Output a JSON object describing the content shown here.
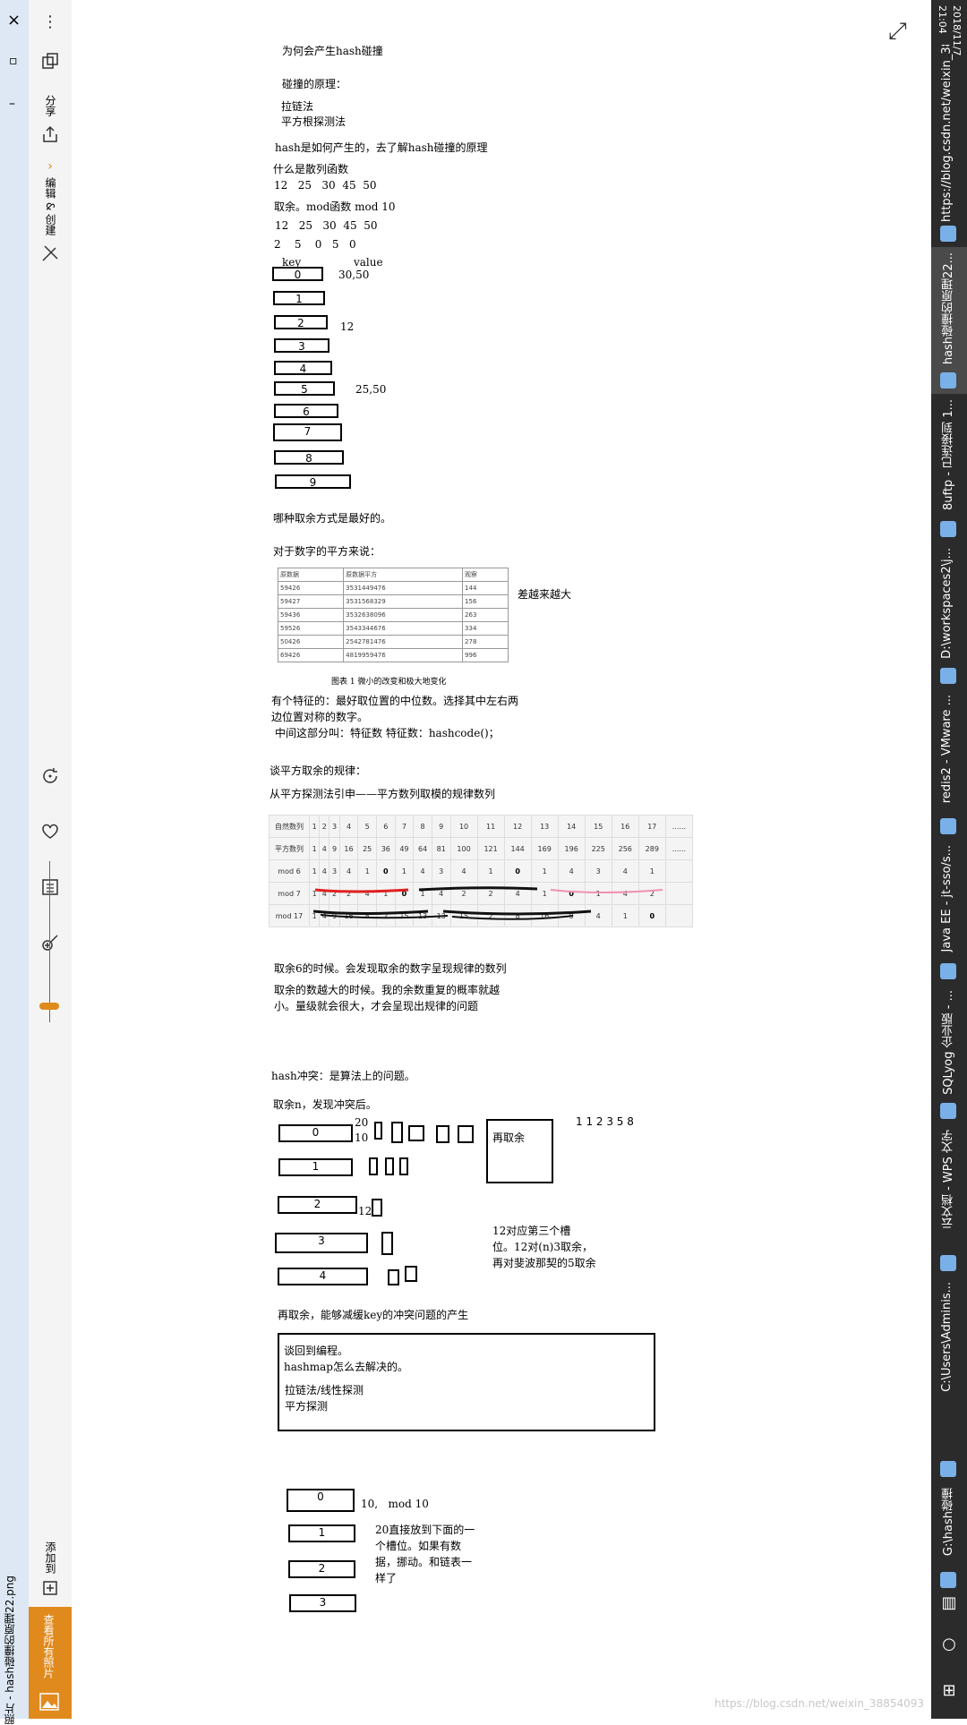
{
  "left_strip": {
    "label": "照片 - hash碰撞的原理22.png",
    "close": "×",
    "minimize": "–",
    "restore": "▫"
  },
  "toolbar": {
    "more": "⋮",
    "share_label": "分享",
    "edit_label": "编辑 & 创建",
    "chevron": "›",
    "add_to_label": "添加到",
    "view_all_label": "查看所有照片",
    "zoom_level": 0.1
  },
  "expand_icon": "⤢",
  "taskbar": {
    "time": "21:04",
    "date": "2018/11/7",
    "items": [
      {
        "label": "https://blog.csdn.net/weixin_38854093"
      },
      {
        "label": "hash碰撞的原理22..."
      },
      {
        "label": "8uftp - 已连接到 1..."
      },
      {
        "label": "D:\\workspaces2\\j..."
      },
      {
        "label": "redis2 - VMware ..."
      },
      {
        "label": "Java EE - jt-sso/s..."
      },
      {
        "label": "SQLyog 企业版 - ..."
      },
      {
        "label": "云文档 - WPS 文字"
      },
      {
        "label": "C:\\Users\\Adminis..."
      },
      {
        "label": "G:\\hash碰撞"
      }
    ]
  },
  "watermark": "https://blog.csdn.net/weixin_38854093",
  "notes": {
    "title": "为何会产生hash碰撞",
    "principle": "碰撞的原理：",
    "method1": "拉链法",
    "method2": "平方根探测法",
    "how": "hash是如何产生的，去了解hash碰撞的原理",
    "what_hash": "什么是散列函数",
    "nums1": "12   25   30  45  50",
    "mod_title": "取余。mod函数 mod 10",
    "nums2": "12   25   30  45  50",
    "nums3": "2    5    0   5   0",
    "key": "key",
    "value": "value",
    "slots": [
      "0",
      "1",
      "2",
      "3",
      "4",
      "5",
      "6",
      "7",
      "8",
      "9"
    ],
    "slot_values": {
      "s0": "30,50",
      "s2": "12",
      "s5": "25,50"
    },
    "best": "哪种取余方式是最好的。",
    "square_intro": "对于数字的平方来说：",
    "diff_note": "差越来越大",
    "caption": "图表 1 微小的改变和极大地变化",
    "feature1": "有个特征的：最好取位置的中位数。选择其中左右两",
    "feature2": "边位置对称的数字。",
    "feature3": "中间这部分叫：特征数    特征数：hashcode()；",
    "rule_title": "谈平方取余的规律：",
    "rule_sub": "从平方探测法引申——平方数列取模的规律数列",
    "obs1": "取余6的时候。会发现取余的数字呈现规律的数列",
    "obs2": "取余的数越大的时候。我的余数重复的概率就越",
    "obs3": "小。量级就会很大，才会呈现出规律的问题",
    "conflict": "hash冲突：是算法上的问题。",
    "after": "取余n，发现冲突后。",
    "v20": "20",
    "v10": "10",
    "v12": "12",
    "reremain": "再取余",
    "fib": "1 1 2 3 5 8",
    "slot12_1": "12对应第三个槽",
    "slot12_2": "位。12对(n)3取余，",
    "slot12_3": "再对斐波那契的5取余",
    "reduce": "再取余，能够减缓key的冲突问题的产生",
    "box1": "谈回到编程。",
    "box2": "hashmap怎么去解决的。",
    "box3": "拉链法/线性探测",
    "box4": "平方探测",
    "bottom_mod": "10,   mod 10",
    "b1": "20直接放到下面的一",
    "b2": "个槽位。如果有数",
    "b3": "据，挪动。和链表一",
    "b4": "样了",
    "slots2": [
      "0",
      "1",
      "2",
      "3",
      "4"
    ],
    "slots3": [
      "0",
      "1",
      "2",
      "3"
    ]
  },
  "small_table": {
    "header": [
      "原数据",
      "原数据平方",
      "观察"
    ],
    "rows": [
      [
        "59426",
        "3531449476",
        "144"
      ],
      [
        "59427",
        "3531568329",
        "156"
      ],
      [
        "59436",
        "3532638096",
        "263"
      ],
      [
        "59526",
        "3543344676",
        "334"
      ],
      [
        "50426",
        "2542781476",
        "278"
      ],
      [
        "69426",
        "4819959476",
        "996"
      ]
    ]
  },
  "seq_table": {
    "rows": [
      {
        "label": "自然数列",
        "cells": [
          "1",
          "2",
          "3",
          "4",
          "5",
          "6",
          "7",
          "8",
          "9",
          "10",
          "11",
          "12",
          "13",
          "14",
          "15",
          "16",
          "17",
          "......"
        ]
      },
      {
        "label": "平方数列",
        "cells": [
          "1",
          "4",
          "9",
          "16",
          "25",
          "36",
          "49",
          "64",
          "81",
          "100",
          "121",
          "144",
          "169",
          "196",
          "225",
          "256",
          "289",
          "......"
        ]
      },
      {
        "label": "mod 6",
        "cells": [
          "1",
          "4",
          "3",
          "4",
          "1",
          "0",
          "1",
          "4",
          "3",
          "4",
          "1",
          "0",
          "1",
          "4",
          "3",
          "4",
          "1",
          ""
        ]
      },
      {
        "label": "mod 7",
        "cells": [
          "1",
          "4",
          "2",
          "2",
          "4",
          "1",
          "0",
          "1",
          "4",
          "2",
          "2",
          "4",
          "1",
          "0",
          "1",
          "4",
          "2",
          ""
        ]
      },
      {
        "label": "mod 17",
        "cells": [
          "1",
          "4",
          "9",
          "16",
          "8",
          "2",
          "15",
          "13",
          "13",
          "15",
          "2",
          "8",
          "16",
          "9",
          "4",
          "1",
          "0",
          ""
        ]
      }
    ]
  }
}
